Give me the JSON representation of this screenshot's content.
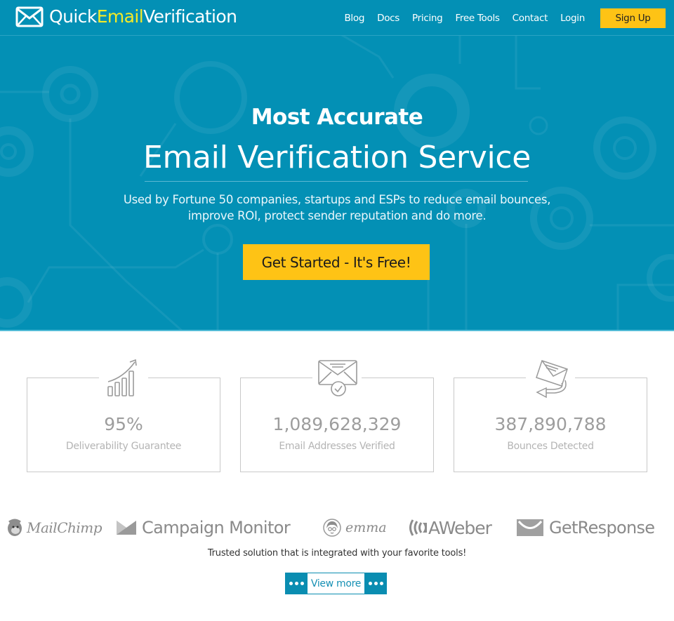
{
  "brand": {
    "name_part1": "Quick",
    "name_part2": "Email",
    "name_part3": "Verification",
    "logo_icon": "envelope-icon",
    "primary_color": "#0390b5",
    "accent_color": "#fec315",
    "logo_accent_color": "#f4ea27"
  },
  "nav": {
    "items": [
      {
        "label": "Blog"
      },
      {
        "label": "Docs"
      },
      {
        "label": "Pricing"
      },
      {
        "label": "Free Tools"
      },
      {
        "label": "Contact"
      },
      {
        "label": "Login"
      }
    ],
    "signup_label": "Sign Up"
  },
  "hero": {
    "kicker": "Most Accurate",
    "title": "Email Verification Service",
    "subtitle_line1": "Used by Fortune 50 companies, startups and ESPs to reduce email bounces,",
    "subtitle_line2": "improve ROI, protect sender reputation and do more.",
    "cta_label": "Get Started - It's Free!"
  },
  "stats": [
    {
      "icon": "growth-chart-icon",
      "value": "95%",
      "label": "Deliverability Guarantee"
    },
    {
      "icon": "verified-envelope-icon",
      "value": "1,089,628,329",
      "label": "Email Addresses Verified"
    },
    {
      "icon": "bounced-envelope-icon",
      "value": "387,890,788",
      "label": "Bounces Detected"
    }
  ],
  "partners": [
    {
      "name": "MailChimp",
      "icon": "mailchimp-logo-icon"
    },
    {
      "name": "Campaign Monitor",
      "icon": "campaign-monitor-logo-icon"
    },
    {
      "name": "emma",
      "icon": "emma-logo-icon"
    },
    {
      "name": "AWeber",
      "icon": "aweber-logo-icon"
    },
    {
      "name": "GetResponse",
      "icon": "getresponse-logo-icon"
    }
  ],
  "trusted_text": "Trusted solution that is integrated with your favorite tools!",
  "view_more_label": "View more"
}
